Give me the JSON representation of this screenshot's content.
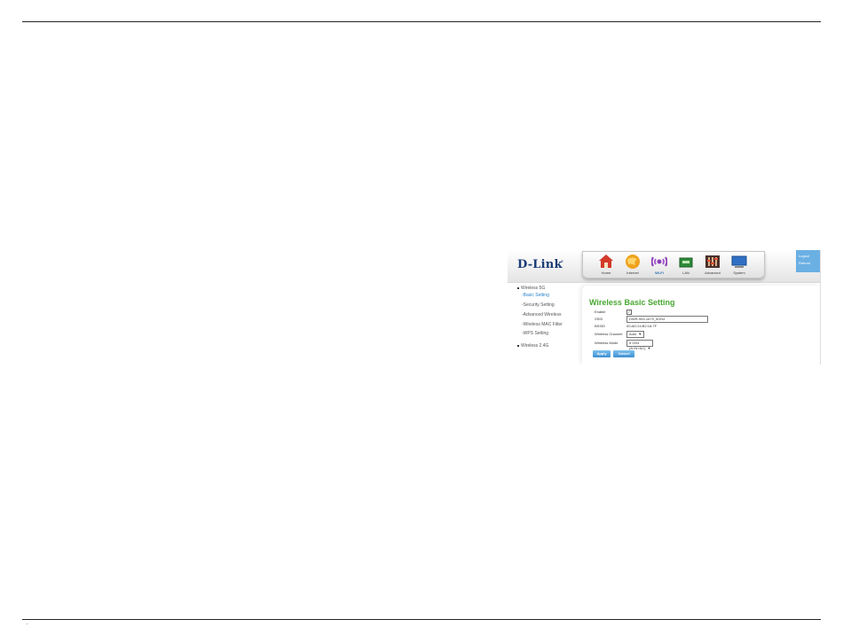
{
  "router": {
    "brand": "D-Link",
    "brand_mark": "®",
    "nav": [
      {
        "label": "Home",
        "icon": "home-icon"
      },
      {
        "label": "Internet",
        "icon": "globe-icon"
      },
      {
        "label": "Wi-Fi",
        "icon": "wifi-icon"
      },
      {
        "label": "LAN",
        "icon": "lan-icon"
      },
      {
        "label": "Advanced",
        "icon": "advanced-icon"
      },
      {
        "label": "System",
        "icon": "monitor-icon"
      }
    ],
    "logout": {
      "line1": "Logout",
      "line2": "Reboot"
    },
    "sidebar": {
      "group_5g": "Wireless 5G",
      "items_5g": [
        "-Basic Setting",
        "-Security Setting",
        "-Advanced Wireless",
        "-Wireless MAC Filter",
        "-WPS Setting"
      ],
      "group_24g": "Wireless 2.4G"
    },
    "form": {
      "title": "Wireless Basic Setting",
      "enable_label": "Enable",
      "enable_checked": "✓",
      "ssid_label": "SSID",
      "ssid_value": "DWR-953-1679_5GHz",
      "bssid_label": "BSSID",
      "bssid_value": "00:AD:24:B2:16:7F",
      "channel_label": "Wireless Channel",
      "channel_value": "Auto",
      "mode_label": "Wireless Mode",
      "mode_value": "5 GHz (A+N+AC)",
      "apply_label": "Apply",
      "cancel_label": "Cancel"
    }
  }
}
